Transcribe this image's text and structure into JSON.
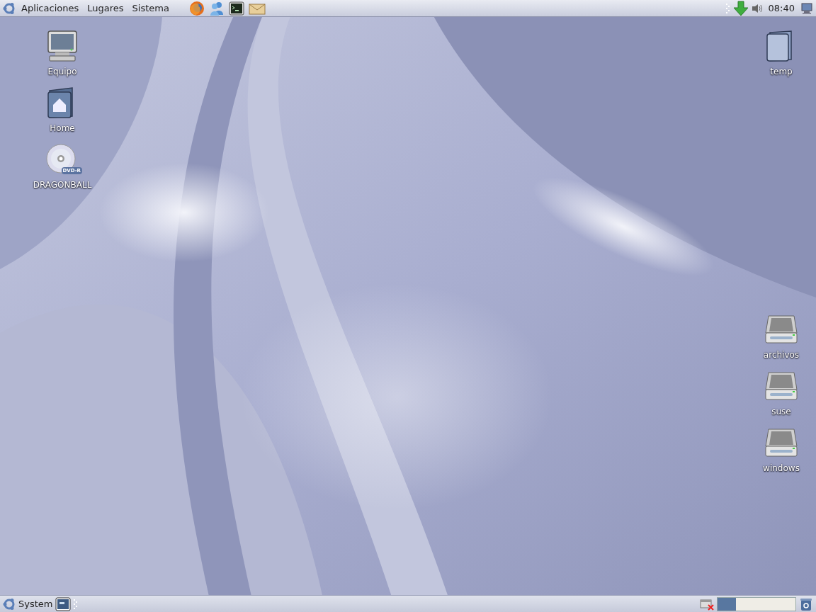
{
  "top_panel": {
    "menus": [
      {
        "label": "Aplicaciones"
      },
      {
        "label": "Lugares"
      },
      {
        "label": "Sistema"
      }
    ],
    "launchers": [
      {
        "kind": "browser"
      },
      {
        "kind": "messenger"
      },
      {
        "kind": "terminal"
      },
      {
        "kind": "mail"
      }
    ],
    "clock": "08:40"
  },
  "left_icons": [
    {
      "kind": "computer",
      "label": "Equipo"
    },
    {
      "kind": "home",
      "label": "Home"
    },
    {
      "kind": "dvd",
      "label": "DRAGONBALL",
      "badge": "DVD-R"
    }
  ],
  "right_icons": [
    {
      "kind": "folder",
      "label": "temp"
    },
    {
      "kind": "drive",
      "label": "archivos"
    },
    {
      "kind": "drive",
      "label": "suse"
    },
    {
      "kind": "drive",
      "label": "windows"
    }
  ],
  "bottom_panel": {
    "menu": "System",
    "workspaces": [
      {
        "selected": true
      },
      {
        "selected": false
      }
    ]
  }
}
